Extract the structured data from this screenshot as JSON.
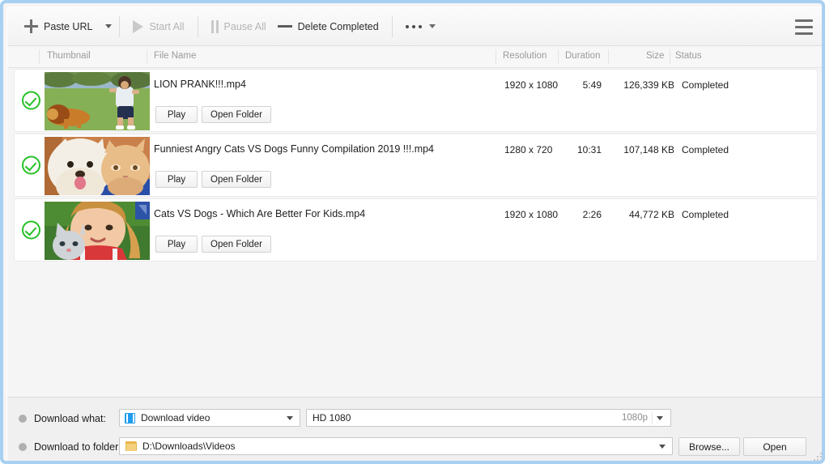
{
  "toolbar": {
    "paste_url": "Paste URL",
    "start_all": "Start All",
    "pause_all": "Pause All",
    "delete_completed": "Delete Completed"
  },
  "list_header": {
    "thumbnail": "Thumbnail",
    "file_name": "File Name",
    "resolution": "Resolution",
    "duration": "Duration",
    "size": "Size",
    "status": "Status"
  },
  "row_actions": {
    "play": "Play",
    "open_folder": "Open Folder"
  },
  "downloads": [
    {
      "file_name": "LION PRANK!!!.mp4",
      "resolution": "1920 x 1080",
      "duration": "5:49",
      "size": "126,339 KB",
      "status": "Completed"
    },
    {
      "file_name": "Funniest Angry Cats VS Dogs Funny Compilation 2019 !!!.mp4",
      "resolution": "1280 x 720",
      "duration": "10:31",
      "size": "107,148 KB",
      "status": "Completed"
    },
    {
      "file_name": "Cats VS Dogs - Which Are Better For Kids.mp4",
      "resolution": "1920 x 1080",
      "duration": "2:26",
      "size": "44,772 KB",
      "status": "Completed"
    }
  ],
  "bottom_panel": {
    "download_what_label": "Download what:",
    "download_what_value": "Download video",
    "quality_value": "HD 1080",
    "quality_badge": "1080p",
    "download_to_folder_label": "Download to folder:",
    "folder_value": "D:\\Downloads\\Videos",
    "browse": "Browse...",
    "open": "Open"
  },
  "colors": {
    "window_border": "#a7d0f2",
    "check_green": "#27c127",
    "film_blue": "#1e9cf0",
    "folder_yellow": "#e8b64a"
  }
}
